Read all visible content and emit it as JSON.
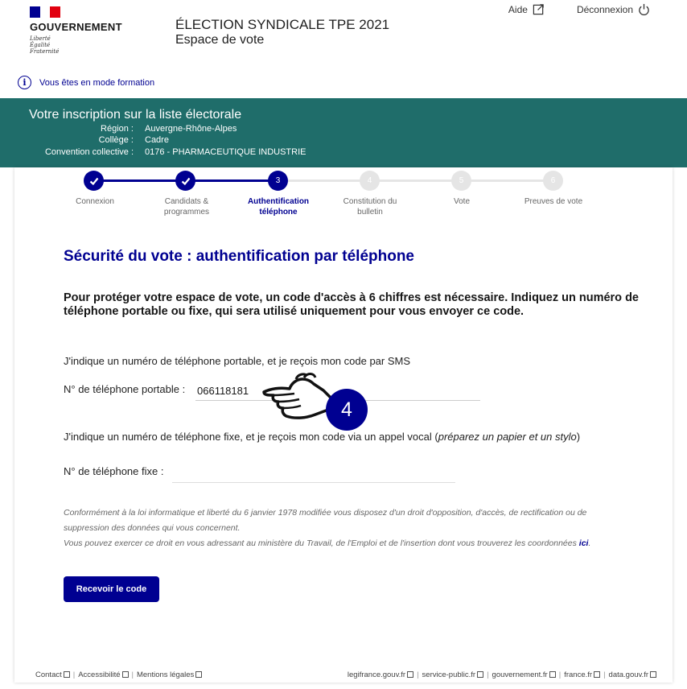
{
  "header": {
    "gov_name": "GOUVERNEMENT",
    "motto": [
      "Liberté",
      "Égalité",
      "Fraternité"
    ],
    "title": "ÉLECTION SYNDICALE TPE 2021",
    "subtitle": "Espace de vote",
    "help_label": "Aide",
    "logout_label": "Déconnexion"
  },
  "formation_notice": "Vous êtes en mode formation",
  "banner": {
    "title": "Votre inscription sur la liste électorale",
    "rows": [
      {
        "key": "Région :",
        "value": "Auvergne-Rhône-Alpes"
      },
      {
        "key": "Collège :",
        "value": "Cadre"
      },
      {
        "key": "Convention collective :",
        "value": "0176 - PHARMACEUTIQUE INDUSTRIE"
      }
    ]
  },
  "stepper": {
    "steps": [
      {
        "num": "1",
        "label": "Connexion",
        "state": "done"
      },
      {
        "num": "2",
        "label": "Candidats & programmes",
        "state": "done"
      },
      {
        "num": "3",
        "label": "Authentification téléphone",
        "state": "current"
      },
      {
        "num": "4",
        "label": "Constitution du bulletin",
        "state": "todo"
      },
      {
        "num": "5",
        "label": "Vote",
        "state": "todo"
      },
      {
        "num": "6",
        "label": "Preuves de vote",
        "state": "todo"
      }
    ]
  },
  "main": {
    "title": "Sécurité du vote : authentification par téléphone",
    "intro": "Pour protéger votre espace de vote, un code d'accès à 6 chiffres est nécessaire. Indiquez un numéro de téléphone portable ou fixe, qui sera utilisé uniquement pour vous envoyer ce code.",
    "mobile_question": "J'indique un numéro de téléphone portable, et je reçois mon code par SMS",
    "mobile_label": "N° de téléphone portable :",
    "mobile_value": "066118181",
    "fixed_question": "J'indique un numéro de téléphone fixe, et je reçois mon code via un appel vocal (",
    "fixed_question_em": "préparez un papier et un stylo",
    "fixed_question_end": ")",
    "fixed_label": "N° de téléphone fixe :",
    "fixed_value": "",
    "legal_1": "Conformément à la loi informatique et liberté du 6 janvier 1978 modifiée vous disposez d'un droit d'opposition, d'accès, de rectification ou de suppression des données qui vous concernent.",
    "legal_2": "Vous pouvez exercer ce droit en vous adressant au ministère du Travail, de l'Emploi et de l'insertion dont vous trouverez les coordonnées ",
    "legal_link": "ici",
    "legal_end": ".",
    "submit_label": "Recevoir le code"
  },
  "annotation": {
    "badge": "4",
    "icon": "pointing-hand-icon"
  },
  "footer": {
    "left_links": [
      "Contact",
      "Accessibilité",
      "Mentions légales"
    ],
    "right_links": [
      "legifrance.gouv.fr",
      "service-public.fr",
      "gouvernement.fr",
      "france.fr",
      "data.gouv.fr"
    ]
  },
  "colors": {
    "primary": "#000091",
    "banner": "#1f6d6a",
    "flag_red": "#e1000f"
  }
}
